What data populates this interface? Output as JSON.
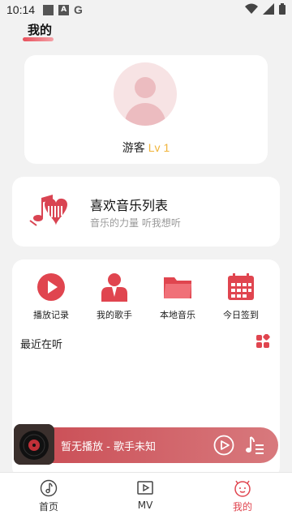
{
  "status_bar": {
    "time": "10:14",
    "a_label": "A",
    "g_label": "G"
  },
  "page": {
    "title": "我的"
  },
  "profile": {
    "name": "游客",
    "level": "Lv 1"
  },
  "favorites": {
    "title": "喜欢音乐列表",
    "subtitle": "音乐的力量 听我想听"
  },
  "quick_actions": [
    {
      "label": "播放记录",
      "icon": "play-circle-icon"
    },
    {
      "label": "我的歌手",
      "icon": "singer-icon"
    },
    {
      "label": "本地音乐",
      "icon": "folder-icon"
    },
    {
      "label": "今日签到",
      "icon": "calendar-icon"
    }
  ],
  "recent": {
    "label": "最近在听"
  },
  "player": {
    "text": "暂无播放 - 歌手未知"
  },
  "nav": [
    {
      "label": "首页",
      "icon": "music-note-icon"
    },
    {
      "label": "MV",
      "icon": "video-icon"
    },
    {
      "label": "我的",
      "icon": "smile-icon"
    }
  ],
  "colors": {
    "accent": "#e0454f",
    "level": "#f0b43a",
    "player": "#c94a52"
  }
}
